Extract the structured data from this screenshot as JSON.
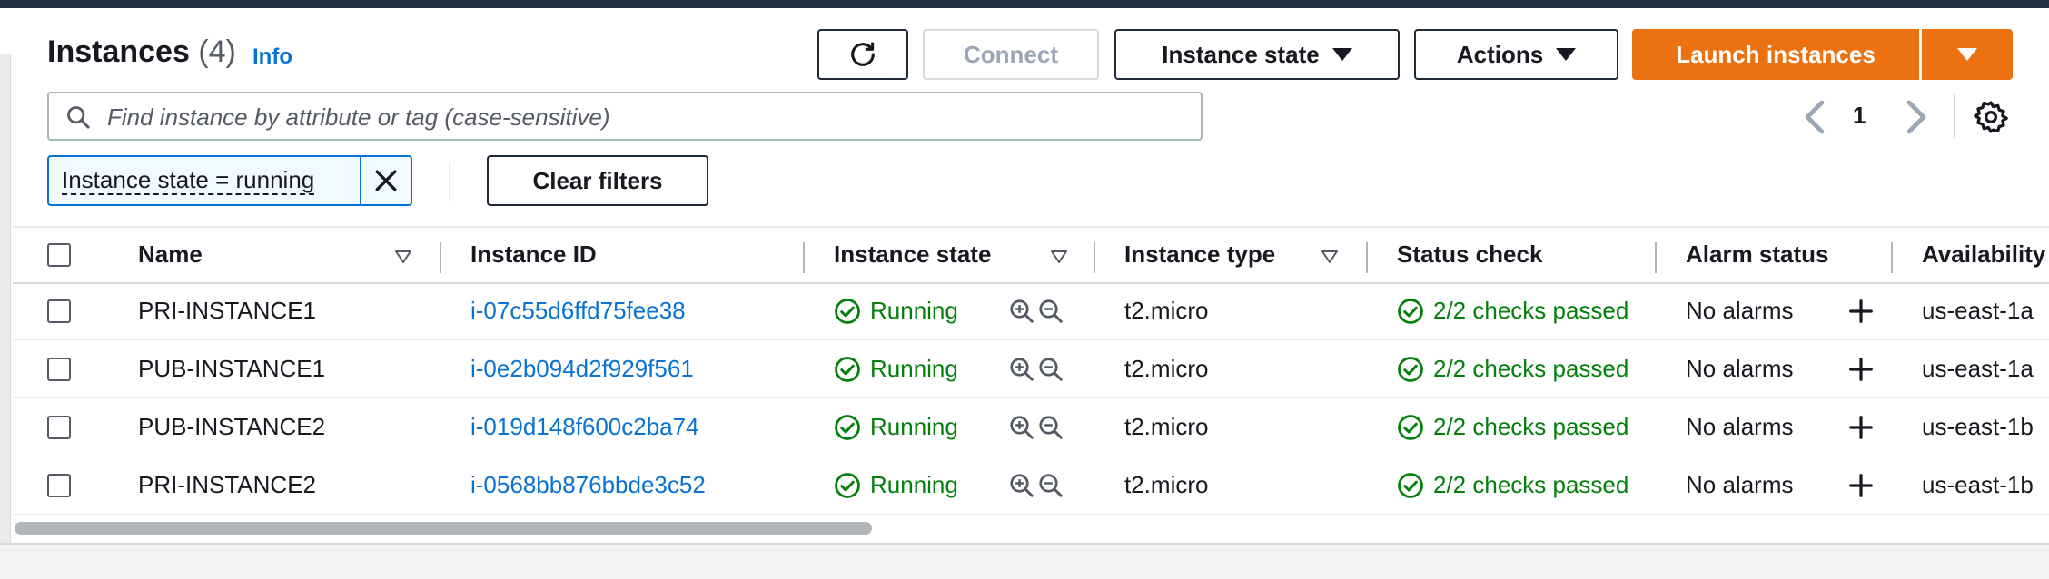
{
  "header": {
    "title": "Instances",
    "count": "(4)",
    "info_label": "Info"
  },
  "toolbar": {
    "refresh_icon": "refresh-icon",
    "connect_label": "Connect",
    "instance_state_label": "Instance state",
    "actions_label": "Actions",
    "launch_label": "Launch instances"
  },
  "search": {
    "placeholder": "Find instance by attribute or tag (case-sensitive)",
    "value": ""
  },
  "pagination": {
    "current_page": "1"
  },
  "filter": {
    "token_label": "Instance state = running",
    "clear_label": "Clear filters"
  },
  "table": {
    "columns": {
      "name": "Name",
      "instance_id": "Instance ID",
      "instance_state": "Instance state",
      "instance_type": "Instance type",
      "status_check": "Status check",
      "alarm_status": "Alarm status",
      "availability_zone": "Availability"
    },
    "rows": [
      {
        "name": "PRI-INSTANCE1",
        "instance_id": "i-07c55d6ffd75fee38",
        "state": "Running",
        "type": "t2.micro",
        "status": "2/2 checks passed",
        "alarm": "No alarms",
        "az": "us-east-1a"
      },
      {
        "name": "PUB-INSTANCE1",
        "instance_id": "i-0e2b094d2f929f561",
        "state": "Running",
        "type": "t2.micro",
        "status": "2/2 checks passed",
        "alarm": "No alarms",
        "az": "us-east-1a"
      },
      {
        "name": "PUB-INSTANCE2",
        "instance_id": "i-019d148f600c2ba74",
        "state": "Running",
        "type": "t2.micro",
        "status": "2/2 checks passed",
        "alarm": "No alarms",
        "az": "us-east-1b"
      },
      {
        "name": "PRI-INSTANCE2",
        "instance_id": "i-0568bb876bbde3c52",
        "state": "Running",
        "type": "t2.micro",
        "status": "2/2 checks passed",
        "alarm": "No alarms",
        "az": "us-east-1b"
      }
    ]
  },
  "colors": {
    "primary": "#ec7211",
    "link": "#0972d3",
    "success": "#037f0c",
    "topbar": "#232f3e"
  }
}
